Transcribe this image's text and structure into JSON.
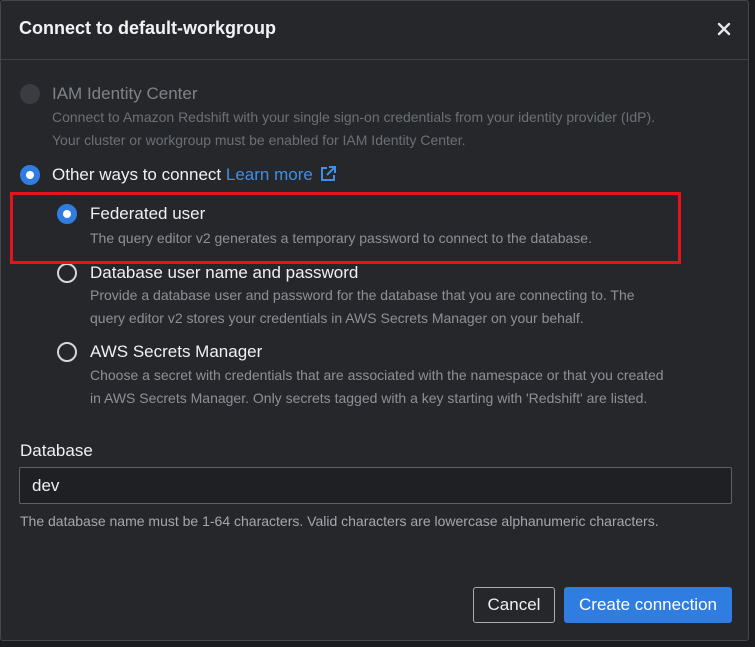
{
  "dialog": {
    "title": "Connect to default-workgroup",
    "close_glyph": "×"
  },
  "background_peek": "a",
  "options": {
    "iam": {
      "label": "IAM Identity Center",
      "desc_1": "Connect to Amazon Redshift with your single sign-on credentials from your identity provider (IdP).",
      "desc_2": "Your cluster or workgroup must be enabled for IAM Identity Center.",
      "state": "disabled"
    },
    "other": {
      "label": "Other ways to connect",
      "learn_more": "Learn more",
      "state": "selected"
    },
    "federated": {
      "label": "Federated user",
      "desc_1": "The query editor v2 generates a temporary password to connect to the database.",
      "state": "selected"
    },
    "dbuser": {
      "label": "Database user name and password",
      "desc_1": "Provide a database user and password for the database that you are connecting to. The",
      "desc_2": "query editor v2 stores your credentials in AWS Secrets Manager on your behalf.",
      "state": "unselected"
    },
    "secrets": {
      "label": "AWS Secrets Manager",
      "desc_1": "Choose a secret with credentials that are associated with the namespace or that you created",
      "desc_2": "in AWS Secrets Manager. Only secrets tagged with a key starting with 'Redshift' are listed.",
      "state": "unselected"
    }
  },
  "database": {
    "label": "Database",
    "value": "dev",
    "hint": "The database name must be 1-64 characters. Valid characters are lowercase alphanumeric characters."
  },
  "footer": {
    "cancel_label": "Cancel",
    "create_label": "Create connection"
  },
  "colors": {
    "accent": "#2f7de1",
    "link": "#3d8fe8",
    "highlight": "#e8131a",
    "dialog_bg": "#25272b"
  },
  "icons": {
    "close": "close-icon",
    "external_link": "external-link-icon"
  }
}
